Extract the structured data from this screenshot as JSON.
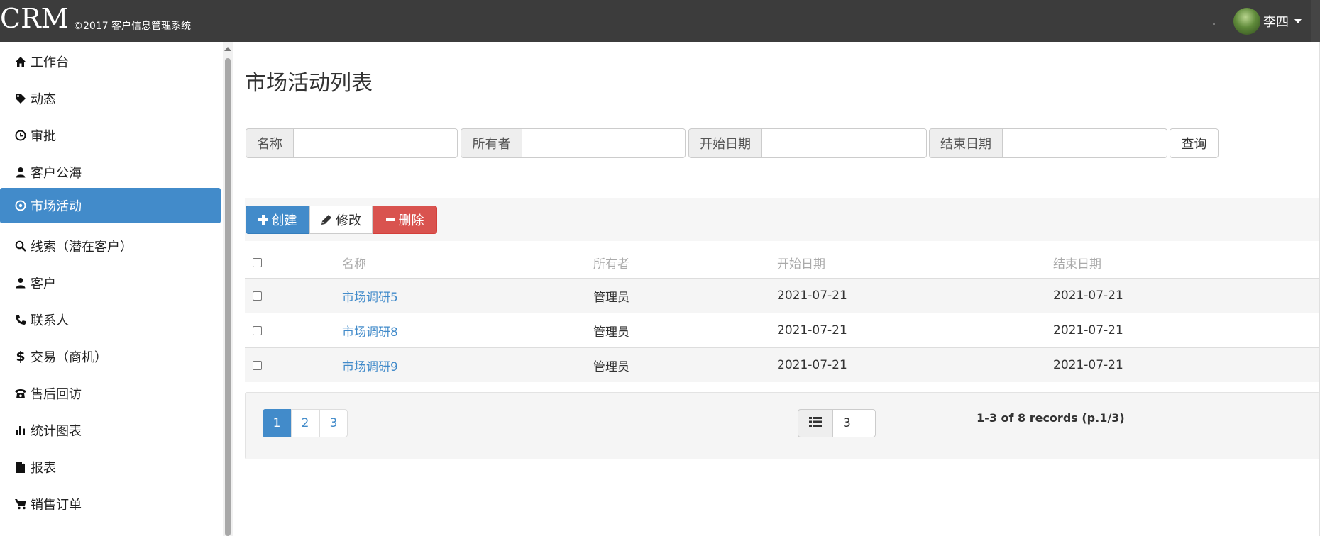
{
  "header": {
    "brand": "CRM",
    "copyright": "©2017 客户信息管理系统",
    "user_name": "李四"
  },
  "sidebar": {
    "items": [
      {
        "label": "工作台",
        "icon": "home-icon"
      },
      {
        "label": "动态",
        "icon": "tag-icon"
      },
      {
        "label": "审批",
        "icon": "clock-icon"
      },
      {
        "label": "客户公海",
        "icon": "user-icon"
      },
      {
        "label": "市场活动",
        "icon": "play-circle-icon",
        "active": true
      },
      {
        "label": "线索（潜在客户）",
        "icon": "search-icon"
      },
      {
        "label": "客户",
        "icon": "user-icon"
      },
      {
        "label": "联系人",
        "icon": "phone-icon"
      },
      {
        "label": "交易（商机）",
        "icon": "dollar-icon"
      },
      {
        "label": "售后回访",
        "icon": "phone-alt-icon"
      },
      {
        "label": "统计图表",
        "icon": "bar-chart-icon"
      },
      {
        "label": "报表",
        "icon": "file-icon"
      },
      {
        "label": "销售订单",
        "icon": "cart-icon"
      }
    ]
  },
  "main": {
    "title": "市场活动列表",
    "filters": {
      "name_label": "名称",
      "owner_label": "所有者",
      "start_label": "开始日期",
      "end_label": "结束日期",
      "query_button": "查询",
      "name_value": "",
      "owner_value": "",
      "start_value": "",
      "end_value": ""
    },
    "toolbar": {
      "create": "创建",
      "edit": "修改",
      "delete": "删除"
    },
    "table": {
      "columns": [
        "名称",
        "所有者",
        "开始日期",
        "结束日期"
      ],
      "rows": [
        {
          "name": "市场调研5",
          "owner": "管理员",
          "start": "2021-07-21",
          "end": "2021-07-21"
        },
        {
          "name": "市场调研8",
          "owner": "管理员",
          "start": "2021-07-21",
          "end": "2021-07-21"
        },
        {
          "name": "市场调研9",
          "owner": "管理员",
          "start": "2021-07-21",
          "end": "2021-07-21"
        }
      ]
    },
    "pagination": {
      "pages": [
        "1",
        "2",
        "3"
      ],
      "current_page": "1",
      "rows_per_page": "3",
      "records_text": "1-3 of 8 records (p.1/3)"
    }
  },
  "colors": {
    "topbar": "#3c3c3c",
    "primary": "#428bca",
    "danger": "#d9534f",
    "header_text": "#aaaaaa"
  }
}
